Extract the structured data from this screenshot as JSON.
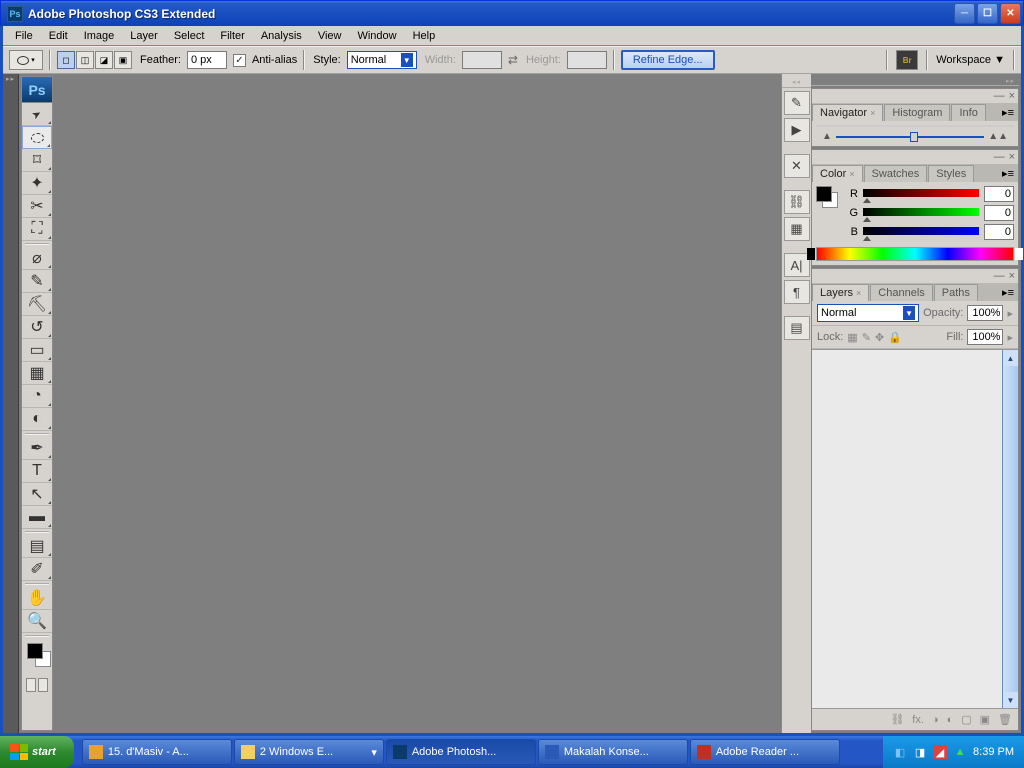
{
  "titlebar": {
    "app_icon": "Ps",
    "title": "Adobe Photoshop CS3 Extended"
  },
  "menubar": [
    "File",
    "Edit",
    "Image",
    "Layer",
    "Select",
    "Filter",
    "Analysis",
    "View",
    "Window",
    "Help"
  ],
  "options": {
    "feather_label": "Feather:",
    "feather_value": "0 px",
    "antialias_label": "Anti-alias",
    "antialias_checked": true,
    "style_label": "Style:",
    "style_value": "Normal",
    "width_label": "Width:",
    "width_value": "",
    "height_label": "Height:",
    "height_value": "",
    "refine_label": "Refine Edge...",
    "workspace_label": "Workspace ▼",
    "bridge_label": "Br"
  },
  "icon_dock": [
    "brush-panel-icon",
    "play-icon",
    "tools-icon",
    "clone-icon",
    "brush-preset-icon",
    "char-icon",
    "para-icon",
    "layercomp-icon"
  ],
  "panels": {
    "navigator": {
      "tabs": [
        "Navigator",
        "Histogram",
        "Info"
      ],
      "active": 0
    },
    "color": {
      "tabs": [
        "Color",
        "Swatches",
        "Styles"
      ],
      "active": 0,
      "r": 0,
      "g": 0,
      "b": 0
    },
    "layers": {
      "tabs": [
        "Layers",
        "Channels",
        "Paths"
      ],
      "active": 0,
      "blend_mode": "Normal",
      "opacity_label": "Opacity:",
      "opacity": "100%",
      "lock_label": "Lock:",
      "fill_label": "Fill:",
      "fill": "100%"
    }
  },
  "taskbar": {
    "start": "start",
    "items": [
      {
        "label": "15. d'Masiv - A...",
        "type": "media"
      },
      {
        "label": "2 Windows E...",
        "type": "folder"
      },
      {
        "label": "Adobe Photosh...",
        "type": "ps"
      },
      {
        "label": "Makalah Konse...",
        "type": "word"
      },
      {
        "label": "Adobe Reader ...",
        "type": "ar"
      }
    ],
    "clock": "8:39 PM"
  }
}
